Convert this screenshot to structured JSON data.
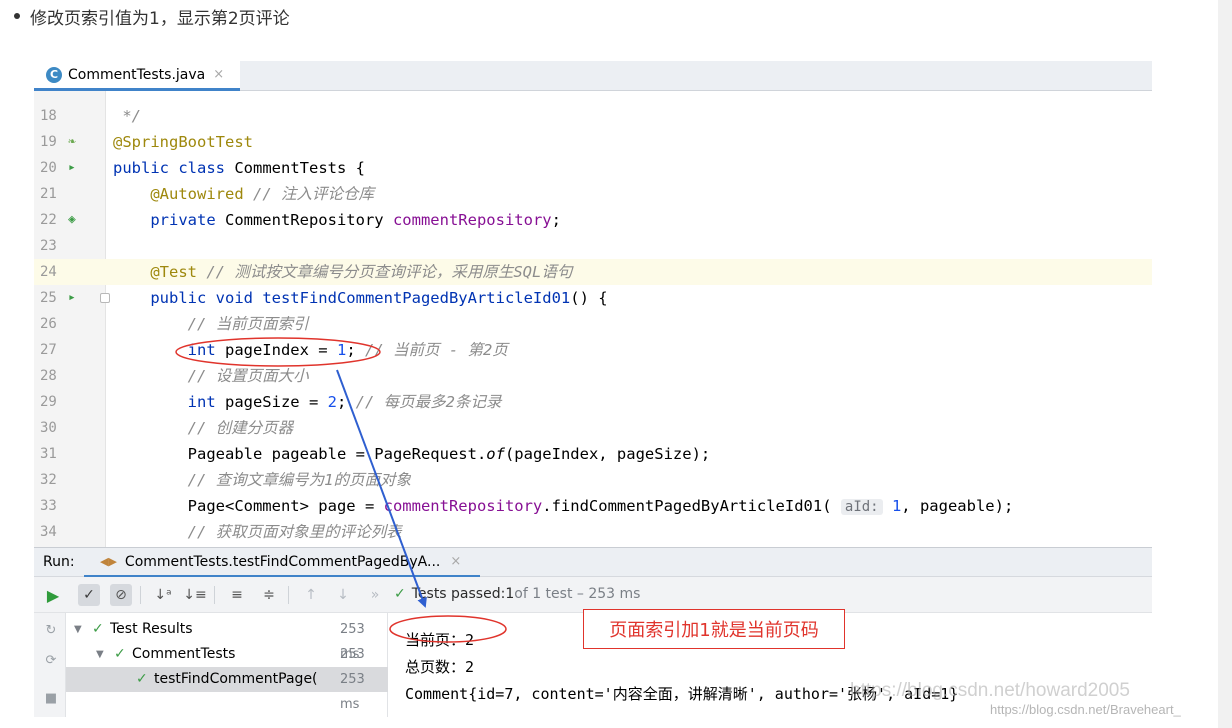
{
  "bullet": {
    "text": "修改页索引值为1，显示第2页评论"
  },
  "editor_tab": {
    "icon": "C",
    "filename": "CommentTests.java",
    "close": "×"
  },
  "code_lines": [
    {
      "num": "18",
      "parts": [
        {
          "t": " */",
          "c": "cmt"
        }
      ]
    },
    {
      "num": "19",
      "icon": "spring-bean-icon",
      "parts": [
        {
          "t": "@SpringBootTest",
          "c": "ann"
        }
      ]
    },
    {
      "num": "20",
      "icon": "run-class-icon",
      "parts": [
        {
          "t": "public class ",
          "c": "kw"
        },
        {
          "t": "CommentTests {",
          "c": ""
        }
      ]
    },
    {
      "num": "21",
      "parts": [
        {
          "t": "    ",
          "c": ""
        },
        {
          "t": "@Autowired",
          "c": "ann"
        },
        {
          "t": " // 注入评论仓库",
          "c": "cmt"
        }
      ]
    },
    {
      "num": "22",
      "icon": "autowired-bean-icon",
      "parts": [
        {
          "t": "    ",
          "c": ""
        },
        {
          "t": "private ",
          "c": "kw"
        },
        {
          "t": "CommentRepository ",
          "c": ""
        },
        {
          "t": "commentRepository",
          "c": "fld"
        },
        {
          "t": ";",
          "c": ""
        }
      ]
    },
    {
      "num": "23",
      "parts": []
    },
    {
      "num": "24",
      "highlight": true,
      "parts": [
        {
          "t": "    ",
          "c": ""
        },
        {
          "t": "@Test",
          "c": "ann"
        },
        {
          "t": " // 测试按文章编号分页查询评论，采用原生SQL语句",
          "c": "cmt"
        }
      ]
    },
    {
      "num": "25",
      "icon": "run-method-icon",
      "fold": true,
      "parts": [
        {
          "t": "    ",
          "c": ""
        },
        {
          "t": "public void ",
          "c": "kw"
        },
        {
          "t": "testFindCommentPagedByArticleId01",
          "c": "kw"
        },
        {
          "t": "() {",
          "c": ""
        }
      ]
    },
    {
      "num": "26",
      "parts": [
        {
          "t": "        ",
          "c": ""
        },
        {
          "t": "// 当前页面索引",
          "c": "cmt"
        }
      ]
    },
    {
      "num": "27",
      "parts": [
        {
          "t": "        ",
          "c": ""
        },
        {
          "t": "int ",
          "c": "kw"
        },
        {
          "t": "pageIndex = ",
          "c": ""
        },
        {
          "t": "1",
          "c": "num"
        },
        {
          "t": ";",
          "c": ""
        },
        {
          "t": " // 当前页 - 第2页",
          "c": "cmt"
        }
      ]
    },
    {
      "num": "28",
      "parts": [
        {
          "t": "        ",
          "c": ""
        },
        {
          "t": "// 设置页面大小",
          "c": "cmt"
        }
      ]
    },
    {
      "num": "29",
      "parts": [
        {
          "t": "        ",
          "c": ""
        },
        {
          "t": "int ",
          "c": "kw"
        },
        {
          "t": "pageSize = ",
          "c": ""
        },
        {
          "t": "2",
          "c": "num"
        },
        {
          "t": ";",
          "c": ""
        },
        {
          "t": " // 每页最多2条记录",
          "c": "cmt"
        }
      ]
    },
    {
      "num": "30",
      "parts": [
        {
          "t": "        ",
          "c": ""
        },
        {
          "t": "// 创建分页器",
          "c": "cmt"
        }
      ]
    },
    {
      "num": "31",
      "parts": [
        {
          "t": "        ",
          "c": ""
        },
        {
          "t": "Pageable pageable = PageRequest.",
          "c": ""
        },
        {
          "t": "of",
          "c": "it"
        },
        {
          "t": "(pageIndex, pageSize);",
          "c": ""
        }
      ]
    },
    {
      "num": "32",
      "parts": [
        {
          "t": "        ",
          "c": ""
        },
        {
          "t": "// 查询文章编号为1的页面对象",
          "c": "cmt"
        }
      ]
    },
    {
      "num": "33",
      "parts": [
        {
          "t": "        ",
          "c": ""
        },
        {
          "t": "Page<Comment> page = ",
          "c": ""
        },
        {
          "t": "commentRepository",
          "c": "fld"
        },
        {
          "t": ".findCommentPagedByArticleId01( ",
          "c": ""
        },
        {
          "t": "aId:",
          "c": "hint"
        },
        {
          "t": " ",
          "c": ""
        },
        {
          "t": "1",
          "c": "num"
        },
        {
          "t": ", pageable);",
          "c": ""
        }
      ]
    },
    {
      "num": "34",
      "parts": [
        {
          "t": "        ",
          "c": ""
        },
        {
          "t": "// 获取页面对象里的评论列表",
          "c": "cmt"
        }
      ]
    }
  ],
  "run_panel": {
    "label": "Run:",
    "tab_title": "CommentTests.testFindCommentPagedByA...",
    "tab_close": "×",
    "status_prefix": "Tests passed: ",
    "status_count": "1",
    "status_suffix": " of 1 test – 253 ms"
  },
  "test_tree": [
    {
      "label": "Test Results",
      "time": "253 ms",
      "indent": 0,
      "expanded": true
    },
    {
      "label": "CommentTests",
      "time": "253 ms",
      "indent": 1,
      "expanded": true
    },
    {
      "label": "testFindCommentPage(",
      "time": "253 ms",
      "indent": 2,
      "selected": true
    }
  ],
  "console_lines": [
    "当前页：2",
    "总页数：2",
    "Comment{id=7, content='内容全面，讲解清晰', author='张杨', aId=1}"
  ],
  "callout": {
    "text": "页面索引加1就是当前页码"
  },
  "watermark": {
    "line1": "https://blog.csdn.net/howard2005",
    "line2": "https://blog.csdn.net/Braveheart_"
  },
  "colors": {
    "annotation_red": "#e0342c",
    "arrow_blue": "#2f5fd0",
    "pass_green": "#3c9c46"
  }
}
